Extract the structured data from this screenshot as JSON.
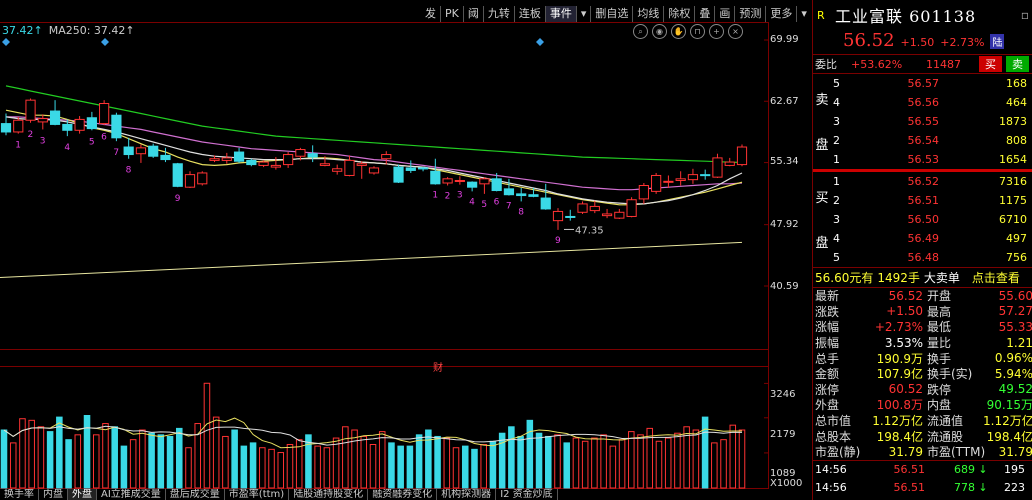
{
  "toolbar": {
    "menu": [
      {
        "label": "发",
        "active": false
      },
      {
        "label": "PK",
        "active": false
      },
      {
        "label": "阈",
        "active": false
      },
      {
        "label": "九转",
        "active": false
      },
      {
        "label": "连板",
        "active": false
      },
      {
        "label": "事件",
        "active": true
      },
      {
        "label": "▾",
        "active": false
      },
      {
        "label": "删自选",
        "active": false
      },
      {
        "label": "均线",
        "active": false
      },
      {
        "label": "除权",
        "active": false
      },
      {
        "label": "叠",
        "active": false
      },
      {
        "label": "画",
        "active": false
      },
      {
        "label": "预测",
        "active": false
      },
      {
        "label": "更多",
        "active": false
      },
      {
        "label": "▾",
        "active": false
      }
    ]
  },
  "ma_legend": {
    "ma": "37.42↑",
    "ma250": "MA250: 37.42↑"
  },
  "chart_icons": [
    "search-icon",
    "eye-icon",
    "hand-icon",
    "lock-icon",
    "plus-icon",
    "close-icon"
  ],
  "price_axis": [
    "69.99",
    "62.67",
    "55.34",
    "47.92",
    "40.59"
  ],
  "volume_axis": [
    "3246",
    "2179",
    "1089",
    "X1000"
  ],
  "annotations": {
    "low_price": "47.35",
    "event_marker": "财"
  },
  "bottom_tabs": [
    "换手率",
    "内盘",
    "外盘",
    "AI立推成交量",
    "盘后成交量",
    "市盈率(ttm)",
    "陆股通持股变化",
    "融资融券变化",
    "机构探测器",
    "I2 资金炒底"
  ],
  "colors": {
    "up": "#ff3333",
    "down": "#3ad9e6",
    "ma_green": "#22cc22",
    "ma_magenta": "#d070d0",
    "ma_yellow": "#e8e060",
    "ma_white": "#e0e0e0"
  },
  "chart_data": [
    {
      "type": "candlestick",
      "title": "",
      "xlabel": "",
      "ylabel": "",
      "ylim": [
        40.59,
        69.99
      ],
      "y_ticks": [
        69.99,
        62.67,
        55.34,
        47.92,
        40.59
      ],
      "candles": [
        {
          "o": 60.0,
          "h": 61.2,
          "l": 58.6,
          "c": 59.0
        },
        {
          "o": 59.0,
          "h": 60.8,
          "l": 58.8,
          "c": 60.4
        },
        {
          "o": 60.4,
          "h": 63.0,
          "l": 60.1,
          "c": 62.8
        },
        {
          "o": 60.2,
          "h": 61.1,
          "l": 59.3,
          "c": 60.6
        },
        {
          "o": 61.5,
          "h": 62.8,
          "l": 59.8,
          "c": 59.9
        },
        {
          "o": 59.9,
          "h": 60.5,
          "l": 58.5,
          "c": 59.2
        },
        {
          "o": 59.2,
          "h": 60.9,
          "l": 58.8,
          "c": 60.5
        },
        {
          "o": 60.7,
          "h": 61.4,
          "l": 59.2,
          "c": 59.4
        },
        {
          "o": 60.0,
          "h": 62.8,
          "l": 59.8,
          "c": 62.4
        },
        {
          "o": 61.0,
          "h": 61.3,
          "l": 57.9,
          "c": 58.3
        },
        {
          "o": 57.2,
          "h": 58.3,
          "l": 55.8,
          "c": 56.3
        },
        {
          "o": 56.4,
          "h": 57.5,
          "l": 55.3,
          "c": 57.1
        },
        {
          "o": 57.3,
          "h": 57.6,
          "l": 55.9,
          "c": 56.1
        },
        {
          "o": 56.2,
          "h": 57.1,
          "l": 55.4,
          "c": 55.7
        },
        {
          "o": 55.2,
          "h": 55.3,
          "l": 52.4,
          "c": 52.5
        },
        {
          "o": 52.4,
          "h": 54.3,
          "l": 52.3,
          "c": 53.9
        },
        {
          "o": 52.8,
          "h": 54.3,
          "l": 52.6,
          "c": 54.1
        },
        {
          "o": 55.6,
          "h": 56.2,
          "l": 55.4,
          "c": 55.8
        },
        {
          "o": 55.6,
          "h": 56.5,
          "l": 55.2,
          "c": 55.9
        },
        {
          "o": 56.6,
          "h": 57.1,
          "l": 55.3,
          "c": 55.5
        },
        {
          "o": 55.6,
          "h": 55.8,
          "l": 54.9,
          "c": 55.1
        },
        {
          "o": 55.0,
          "h": 55.6,
          "l": 54.8,
          "c": 55.4
        },
        {
          "o": 54.8,
          "h": 56.0,
          "l": 54.5,
          "c": 55.0
        },
        {
          "o": 55.1,
          "h": 56.6,
          "l": 54.7,
          "c": 56.3
        },
        {
          "o": 56.1,
          "h": 57.1,
          "l": 55.6,
          "c": 56.9
        },
        {
          "o": 56.4,
          "h": 57.4,
          "l": 55.4,
          "c": 56.0
        },
        {
          "o": 55.0,
          "h": 56.1,
          "l": 54.9,
          "c": 55.2
        },
        {
          "o": 54.3,
          "h": 55.1,
          "l": 53.9,
          "c": 54.6
        },
        {
          "o": 53.8,
          "h": 56.2,
          "l": 53.7,
          "c": 55.6
        },
        {
          "o": 55.0,
          "h": 55.5,
          "l": 53.4,
          "c": 55.2
        },
        {
          "o": 54.1,
          "h": 54.9,
          "l": 53.9,
          "c": 54.7
        },
        {
          "o": 55.8,
          "h": 56.7,
          "l": 55.1,
          "c": 56.3
        },
        {
          "o": 54.8,
          "h": 55.1,
          "l": 52.9,
          "c": 53.0
        },
        {
          "o": 54.7,
          "h": 55.6,
          "l": 54.1,
          "c": 54.4
        },
        {
          "o": 54.7,
          "h": 54.8,
          "l": 54.3,
          "c": 54.6
        },
        {
          "o": 54.3,
          "h": 55.8,
          "l": 52.7,
          "c": 52.8
        },
        {
          "o": 52.9,
          "h": 53.6,
          "l": 52.6,
          "c": 53.4
        },
        {
          "o": 53.1,
          "h": 53.7,
          "l": 52.7,
          "c": 53.2
        },
        {
          "o": 53.0,
          "h": 53.1,
          "l": 51.9,
          "c": 52.4
        },
        {
          "o": 52.8,
          "h": 53.6,
          "l": 51.6,
          "c": 53.4
        },
        {
          "o": 53.4,
          "h": 54.1,
          "l": 51.9,
          "c": 52.0
        },
        {
          "o": 52.2,
          "h": 53.4,
          "l": 51.4,
          "c": 51.5
        },
        {
          "o": 51.6,
          "h": 52.3,
          "l": 50.7,
          "c": 51.4
        },
        {
          "o": 51.5,
          "h": 52.3,
          "l": 51.2,
          "c": 51.3
        },
        {
          "o": 51.1,
          "h": 52.8,
          "l": 49.7,
          "c": 49.8
        },
        {
          "o": 48.4,
          "h": 49.9,
          "l": 47.3,
          "c": 49.5
        },
        {
          "o": 48.9,
          "h": 49.7,
          "l": 48.4,
          "c": 48.8
        },
        {
          "o": 49.4,
          "h": 50.7,
          "l": 49.2,
          "c": 50.4
        },
        {
          "o": 49.6,
          "h": 50.8,
          "l": 49.3,
          "c": 50.1
        },
        {
          "o": 49.0,
          "h": 49.8,
          "l": 48.7,
          "c": 49.2
        },
        {
          "o": 48.7,
          "h": 49.8,
          "l": 48.6,
          "c": 49.4
        },
        {
          "o": 48.9,
          "h": 51.2,
          "l": 48.8,
          "c": 50.9
        },
        {
          "o": 51.0,
          "h": 52.9,
          "l": 50.4,
          "c": 52.6
        },
        {
          "o": 51.9,
          "h": 54.1,
          "l": 51.6,
          "c": 53.8
        },
        {
          "o": 53.0,
          "h": 53.8,
          "l": 52.3,
          "c": 53.1
        },
        {
          "o": 53.2,
          "h": 54.3,
          "l": 52.6,
          "c": 53.4
        },
        {
          "o": 53.3,
          "h": 54.6,
          "l": 52.8,
          "c": 53.9
        },
        {
          "o": 53.9,
          "h": 54.5,
          "l": 53.3,
          "c": 53.8
        },
        {
          "o": 53.6,
          "h": 56.4,
          "l": 53.5,
          "c": 55.9
        },
        {
          "o": 55.0,
          "h": 55.9,
          "l": 54.9,
          "c": 55.4
        },
        {
          "o": 55.1,
          "h": 57.5,
          "l": 54.9,
          "c": 57.2
        }
      ],
      "ma_green": [
        64.5,
        64.2,
        63.9,
        63.6,
        63.3,
        63.0,
        62.7,
        62.4,
        62.1,
        61.8,
        61.5,
        61.2,
        60.9,
        60.6,
        60.3,
        60.0,
        59.7,
        59.5,
        59.3,
        59.1,
        58.9,
        58.7,
        58.5,
        58.4,
        58.3,
        58.2,
        58.1,
        58.0,
        57.9,
        57.8,
        57.7,
        57.6,
        57.5,
        57.4,
        57.3,
        57.2,
        57.1,
        57.0,
        56.9,
        56.8,
        56.7,
        56.6,
        56.5,
        56.4,
        56.3,
        56.2,
        56.1,
        56.0,
        55.95,
        55.9,
        55.85,
        55.8,
        55.75,
        55.7,
        55.65,
        55.6,
        55.55,
        55.5,
        55.45,
        55.4,
        55.35
      ],
      "ma_magenta": [
        60.8,
        60.8,
        60.7,
        60.6,
        60.5,
        60.4,
        60.3,
        60.1,
        59.9,
        59.7,
        59.5,
        59.3,
        59.0,
        58.7,
        58.4,
        58.1,
        57.8,
        57.6,
        57.4,
        57.2,
        57.0,
        56.9,
        56.8,
        56.7,
        56.6,
        56.5,
        56.4,
        56.3,
        56.1,
        55.9,
        55.7,
        55.6,
        55.4,
        55.2,
        55.0,
        54.8,
        54.6,
        54.4,
        54.2,
        54.0,
        53.8,
        53.6,
        53.4,
        53.2,
        53.0,
        52.8,
        52.6,
        52.4,
        52.3,
        52.2,
        52.1,
        52.1,
        52.2,
        52.3,
        52.4,
        52.5,
        52.6,
        52.7,
        52.8,
        52.8,
        52.9
      ],
      "ma_yellow": [
        61.6,
        61.3,
        61.0,
        61.0,
        60.9,
        60.5,
        60.0,
        59.5,
        59.2,
        58.8,
        58.2,
        57.6,
        57.0,
        56.6,
        56.0,
        55.5,
        55.1,
        55.0,
        55.1,
        55.3,
        55.4,
        55.5,
        55.6,
        55.7,
        55.8,
        55.9,
        55.9,
        55.8,
        55.6,
        55.4,
        55.3,
        55.2,
        55.0,
        54.9,
        54.8,
        54.5,
        54.2,
        53.9,
        53.6,
        53.3,
        53.0,
        52.7,
        52.4,
        52.1,
        51.8,
        51.5,
        51.2,
        50.9,
        50.7,
        50.5,
        50.3,
        50.3,
        50.4,
        50.6,
        50.9,
        51.2,
        51.5,
        51.8,
        52.2,
        52.6,
        53.0
      ],
      "ma_white": [
        60.8,
        60.6,
        60.5,
        60.5,
        60.4,
        60.2,
        59.9,
        59.6,
        59.3,
        59.0,
        58.6,
        58.2,
        57.8,
        57.4,
        57.0,
        56.6,
        56.3,
        56.1,
        56.0,
        55.9,
        55.8,
        55.7,
        55.7,
        55.7,
        55.8,
        55.8,
        55.8,
        55.7,
        55.6,
        55.4,
        55.3,
        55.2,
        55.0,
        54.9,
        54.8,
        54.6,
        54.4,
        54.1,
        53.8,
        53.5,
        53.2,
        52.9,
        52.6,
        52.3,
        52.0,
        51.6,
        51.3,
        51.0,
        50.8,
        50.6,
        50.5,
        50.4,
        50.4,
        50.6,
        50.8,
        51.1,
        51.5,
        52.0,
        52.6,
        53.4,
        54.1
      ],
      "ma250_start": 41.6,
      "ma250_end": 45.8,
      "sequence_labels": {
        "top": [
          "1",
          "2",
          "3",
          "4",
          "5",
          "6",
          "7",
          "8",
          "9"
        ],
        "bottom": [
          "1",
          "2",
          "3",
          "4",
          "5",
          "6",
          "7",
          "8",
          "9"
        ]
      }
    },
    {
      "type": "bar",
      "title": "",
      "xlabel": "",
      "ylabel": "",
      "ylim": [
        0,
        3600
      ],
      "y_ticks": [
        3246,
        2179,
        1089
      ],
      "unit": "X1000",
      "values": [
        1800,
        1400,
        2150,
        2100,
        1900,
        1750,
        2200,
        1500,
        1650,
        2250,
        1650,
        2000,
        1900,
        1300,
        1500,
        1800,
        1700,
        1650,
        1600,
        1850,
        1250,
        2000,
        3250,
        2200,
        1600,
        1800,
        1300,
        1400,
        1250,
        1200,
        1100,
        1350,
        1500,
        1650,
        1300,
        1250,
        1550,
        1900,
        1800,
        1600,
        1350,
        1750,
        1400,
        1300,
        1300,
        1650,
        1800,
        1600,
        1550,
        1250,
        1300,
        1200,
        1350,
        1450,
        1700,
        1900,
        1600,
        2100,
        1700,
        1600,
        1650,
        1400,
        1550,
        1450,
        1550,
        1650,
        1300,
        1500,
        1750,
        1650,
        1850,
        1450,
        1550,
        1700,
        1900,
        1800,
        2200,
        1400,
        1500,
        1950,
        1800
      ]
    }
  ],
  "panel": {
    "header": {
      "r": "R",
      "title": "工业富联 601138"
    },
    "price": {
      "last": "56.52",
      "change": "+1.50",
      "pct": "+2.73%",
      "badge": "陆"
    },
    "weibi": {
      "label": "委比",
      "pct": "+53.62%",
      "diff": "11487",
      "buy": "买",
      "sell": "卖"
    },
    "sell_side": "卖盘",
    "buy_side": "买盘",
    "asks": [
      {
        "lv": "5",
        "px": "56.57",
        "vol": "168"
      },
      {
        "lv": "4",
        "px": "56.56",
        "vol": "464"
      },
      {
        "lv": "3",
        "px": "56.55",
        "vol": "1873"
      },
      {
        "lv": "2",
        "px": "56.54",
        "vol": "808"
      },
      {
        "lv": "1",
        "px": "56.53",
        "vol": "1654"
      }
    ],
    "bids": [
      {
        "lv": "1",
        "px": "56.52",
        "vol": "7316"
      },
      {
        "lv": "2",
        "px": "56.51",
        "vol": "1175"
      },
      {
        "lv": "3",
        "px": "56.50",
        "vol": "6710"
      },
      {
        "lv": "4",
        "px": "56.49",
        "vol": "497"
      },
      {
        "lv": "5",
        "px": "56.48",
        "vol": "756"
      }
    ],
    "big_order": {
      "text": "56.60元有",
      "qty": "1492手",
      "label": "大卖单",
      "link": "点击查看"
    },
    "stats": [
      {
        "l1": "最新",
        "v1": "56.52",
        "c1": "red",
        "l2": "开盘",
        "v2": "55.60",
        "c2": "red"
      },
      {
        "l1": "涨跌",
        "v1": "+1.50",
        "c1": "red",
        "l2": "最高",
        "v2": "57.27",
        "c2": "red"
      },
      {
        "l1": "涨幅",
        "v1": "+2.73%",
        "c1": "red",
        "l2": "最低",
        "v2": "55.33",
        "c2": "red"
      },
      {
        "l1": "振幅",
        "v1": "3.53%",
        "c1": "white",
        "l2": "量比",
        "v2": "1.21",
        "c2": "yellow"
      },
      {
        "l1": "总手",
        "v1": "190.9万",
        "c1": "yellow",
        "l2": "换手",
        "v2": "0.96%",
        "c2": "yellow"
      },
      {
        "l1": "金额",
        "v1": "107.9亿",
        "c1": "yellow",
        "l2": "换手(实)",
        "v2": "5.94%",
        "c2": "yellow"
      },
      {
        "l1": "涨停",
        "v1": "60.52",
        "c1": "red",
        "l2": "跌停",
        "v2": "49.52",
        "c2": "green"
      },
      {
        "l1": "外盘",
        "v1": "100.8万",
        "c1": "red",
        "l2": "内盘",
        "v2": "90.15万",
        "c2": "green"
      },
      {
        "l1": "总市值",
        "v1": "1.12万亿",
        "c1": "yellow",
        "l2": "流通值",
        "v2": "1.12万亿",
        "c2": "yellow"
      },
      {
        "l1": "总股本",
        "v1": "198.4亿",
        "c1": "yellow",
        "l2": "流通股",
        "v2": "198.4亿",
        "c2": "yellow"
      },
      {
        "l1": "市盈(静)",
        "v1": "31.79",
        "c1": "yellow",
        "l2": "市盈(TTM)",
        "v2": "31.79",
        "c2": "yellow"
      }
    ],
    "ticks": [
      {
        "t": "14:56",
        "p": "56.51",
        "v": "689",
        "vc": "green",
        "a": "↓",
        "ac": "green",
        "n": "195"
      },
      {
        "t": "14:56",
        "p": "56.51",
        "v": "778",
        "vc": "green",
        "a": "↓",
        "ac": "green",
        "n": "223"
      }
    ]
  }
}
